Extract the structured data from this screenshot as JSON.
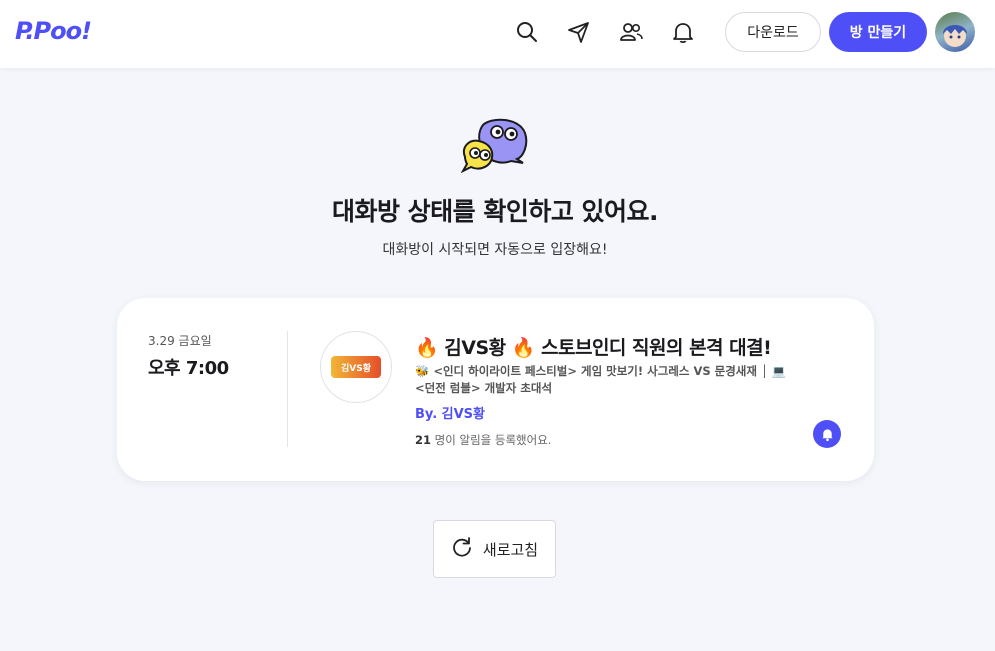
{
  "header": {
    "logo": "P.Poo!",
    "download_label": "다운로드",
    "make_room_label": "방 만들기",
    "icons": [
      "search-icon",
      "paper-plane-icon",
      "users-icon",
      "bell-icon"
    ]
  },
  "main": {
    "title": "대화방 상태를 확인하고 있어요.",
    "subtitle": "대화방이 시작되면 자동으로 입장해요!"
  },
  "card": {
    "date": "3.29 금요일",
    "time": "오후 7:00",
    "thumbnail_text": "김VS황",
    "title": "🔥 김VS황 🔥 스토브인디 직원의 본격 대결!",
    "description": "🐝 <인디 하이라이트 페스티벌> 게임 맛보기! 사그레스 VS 문경새재 │ 💻 <던전 럼블> 개발자 초대석",
    "by": "By. 김VS황",
    "notice_count": "21",
    "notice_text": " 명이 알림을 등록했어요."
  },
  "refresh_label": "새로고침",
  "colors": {
    "accent": "#4e4ff6",
    "background": "#f4f6fc"
  }
}
